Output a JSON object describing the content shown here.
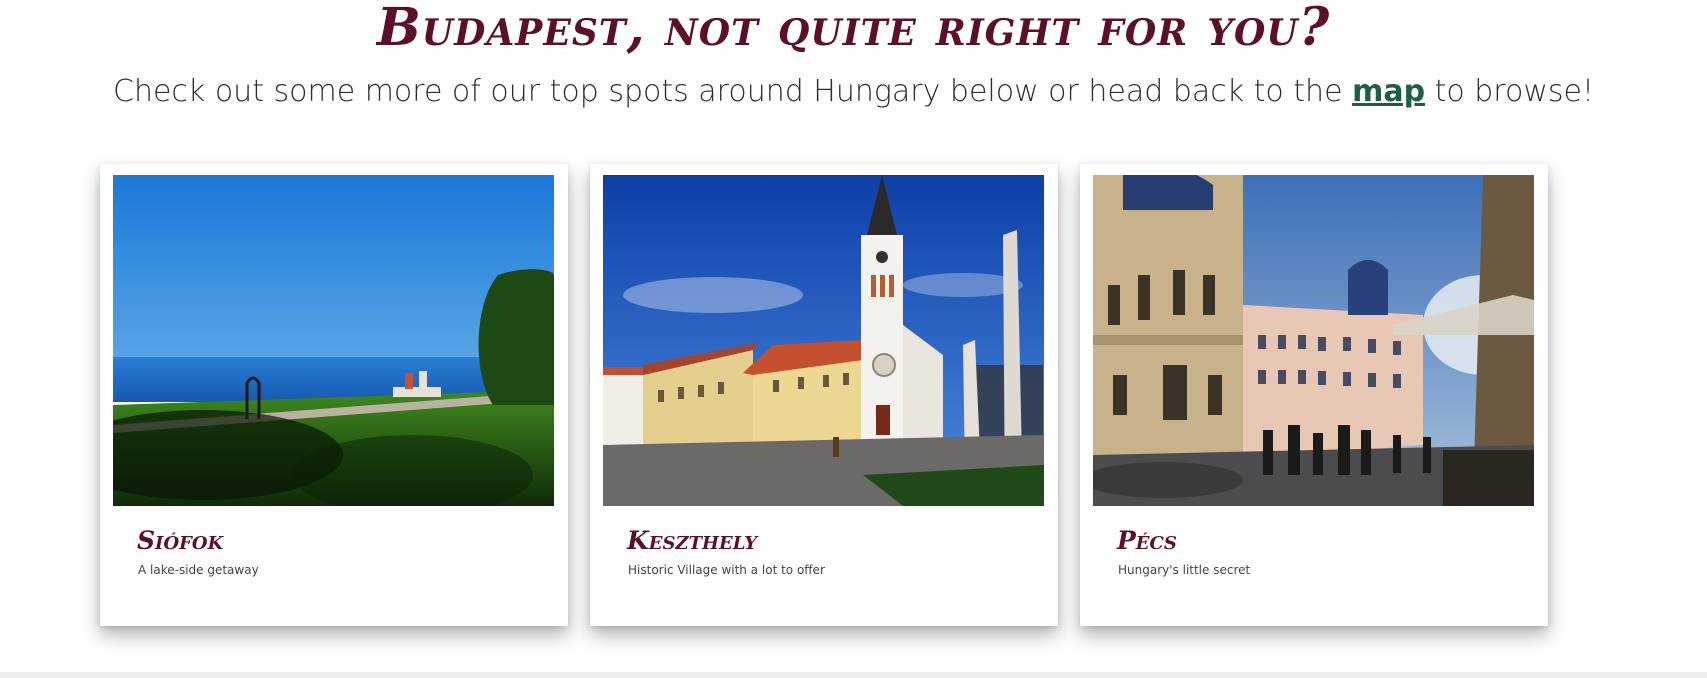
{
  "headline": "Budapest, not quite right for you?",
  "subline": {
    "before": "Check out some more of our top spots around Hungary below or head back to the ",
    "link": "map",
    "after": " to browse!"
  },
  "cards": [
    {
      "name": "Siófok",
      "tagline": "A lake-side getaway",
      "image": "lake-balaton-shore-photo"
    },
    {
      "name": "Keszthely",
      "tagline": "Historic Village with a lot to offer",
      "image": "church-square-photo"
    },
    {
      "name": "Pécs",
      "tagline": "Hungary's little secret",
      "image": "city-street-photo"
    }
  ],
  "colors": {
    "accent": "#5c0f2b",
    "link": "#1e5e45",
    "text": "#2d2d2d"
  }
}
